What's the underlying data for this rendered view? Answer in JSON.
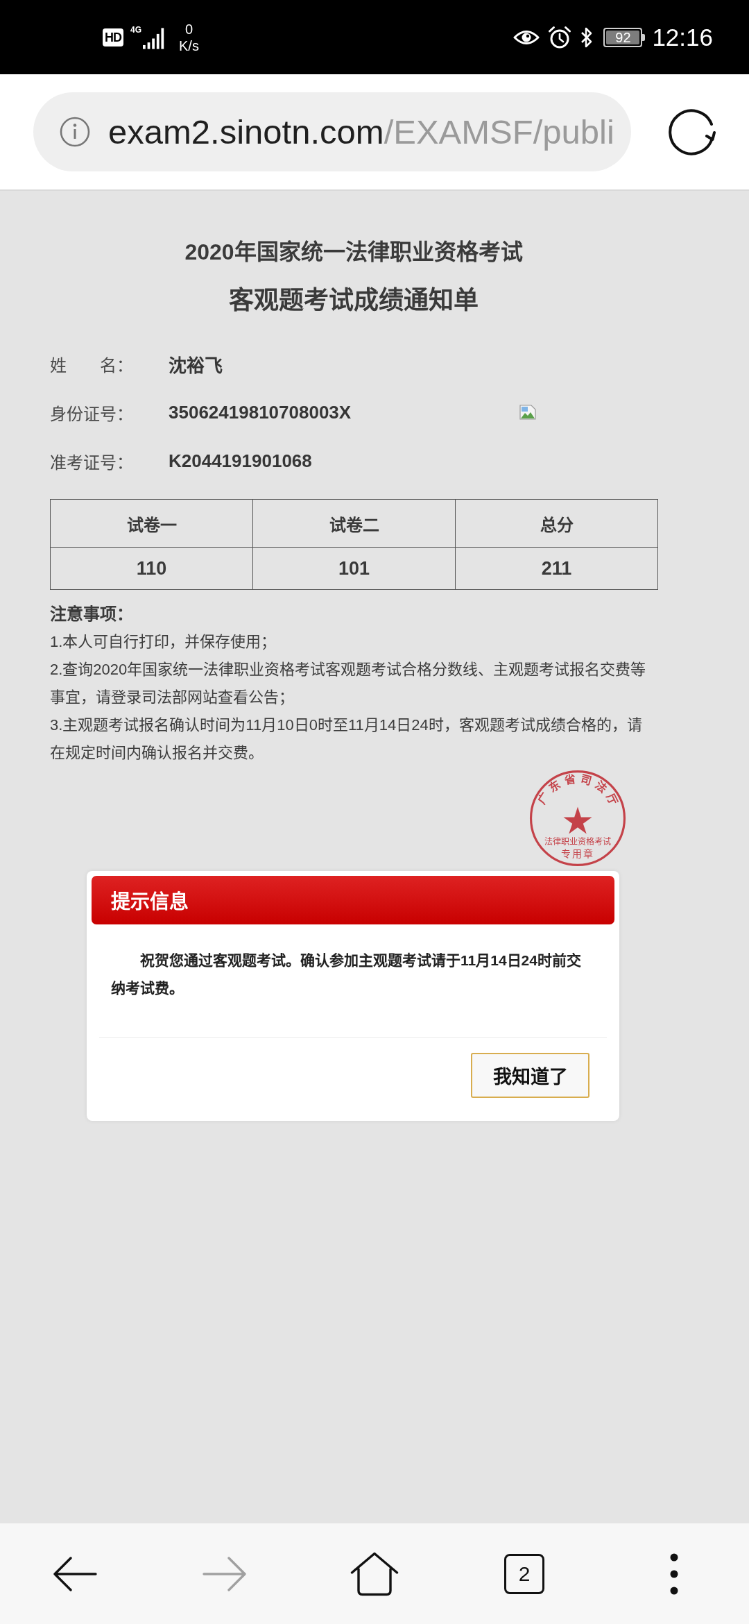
{
  "status_bar": {
    "hd_label": "HD",
    "network_type": "4G",
    "speed_value": "0",
    "speed_unit": "K/s",
    "battery": "92",
    "time": "12:16"
  },
  "address_bar": {
    "domain": "exam2.sinotn.com",
    "path": "/EXAMSF/publi"
  },
  "notice": {
    "title_lines": [
      "2020年国家统一法律职业资格考试",
      "客观题考试成绩通知单"
    ],
    "fields": [
      {
        "label": "姓　　名：",
        "value": "沈裕飞"
      },
      {
        "label": "身份证号：",
        "value": "35062419810708003X"
      },
      {
        "label": "准考证号：",
        "value": "K2044191901068"
      }
    ],
    "photo": {
      "loaded": false
    },
    "score_table": {
      "columns": [
        "试卷一",
        "试卷二",
        "总分"
      ],
      "rows": [
        [
          "110",
          "101",
          "211"
        ]
      ]
    },
    "notes": {
      "heading": "注意事项：",
      "items": [
        "1.本人可自行打印，并保存使用；",
        "2.查询2020年国家统一法律职业资格考试客观题考试合格分数线、主观题考试报名交费等事宜，请登录司法部网站查看公告；",
        "3.主观题考试报名确认时间为11月10日0时至11月14日24时，客观题考试成绩合格的，请在规定时间内确认报名并交费。"
      ]
    },
    "seal": {
      "arc_text": "广东省司法厅",
      "lines": [
        "法律职业资格考试",
        "专用章"
      ]
    }
  },
  "dialog": {
    "title": "提示信息",
    "message": "祝贺您通过客观题考试。确认参加主观题考试请于11月14日24时前交纳考试费。",
    "button": "我知道了"
  },
  "bottom_nav": {
    "items": [
      {
        "kind": "back",
        "disabled": false
      },
      {
        "kind": "forward",
        "disabled": true
      },
      {
        "kind": "home",
        "disabled": false
      },
      {
        "kind": "tabs",
        "label": "2",
        "disabled": false
      },
      {
        "kind": "menu",
        "disabled": false
      }
    ]
  }
}
